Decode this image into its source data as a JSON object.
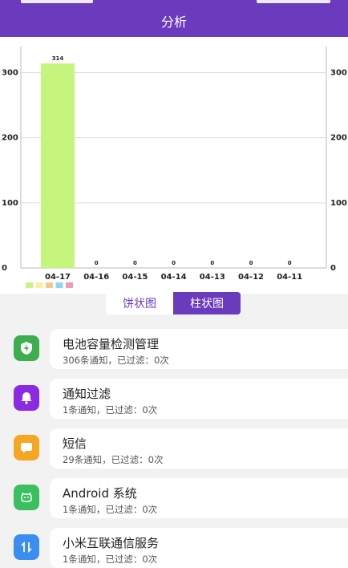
{
  "header": {
    "title": "分析"
  },
  "chart_data": {
    "type": "bar",
    "categories": [
      "04-17",
      "04-16",
      "04-15",
      "04-14",
      "04-13",
      "04-12",
      "04-11"
    ],
    "values": [
      314,
      0,
      0,
      0,
      0,
      0,
      0
    ],
    "data_labels": [
      "314",
      "0",
      "0",
      "0",
      "0",
      "0",
      "0"
    ],
    "y_ticks": [
      0,
      100,
      200,
      300
    ],
    "ylim": [
      0,
      340
    ],
    "bar_color": "#c6f57e",
    "legend_colors": [
      "#c6f57e",
      "#f6f0a0",
      "#f6c98a",
      "#8fd6f0",
      "#f49ab8"
    ],
    "grid": true
  },
  "toggle": {
    "pie_label": "饼状图",
    "bar_label": "柱状图",
    "active": "bar"
  },
  "apps": [
    {
      "name": "电池容量检测管理",
      "stats": "306条通知，已过滤：0次",
      "icon": "battery-shield-icon",
      "color": "#3dae4e"
    },
    {
      "name": "通知过滤",
      "stats": "1条通知，已过滤：0次",
      "icon": "bell-icon",
      "color": "#8a2be2"
    },
    {
      "name": "短信",
      "stats": "29条通知，已过滤：0次",
      "icon": "message-icon",
      "color": "#f5a623"
    },
    {
      "name": "Android 系统",
      "stats": "1条通知，已过滤：0次",
      "icon": "android-icon",
      "color": "#3ac060"
    },
    {
      "name": "小米互联通信服务",
      "stats": "1条通知，已过滤：0次",
      "icon": "transfer-icon",
      "color": "#3b8ef0"
    }
  ]
}
